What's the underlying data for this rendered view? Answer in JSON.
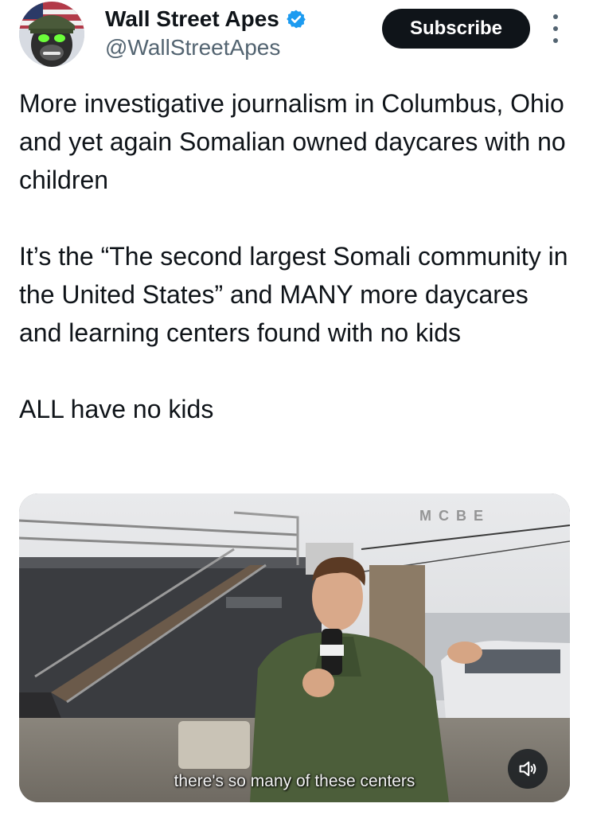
{
  "tweet": {
    "author": {
      "display_name": "Wall Street Apes",
      "handle": "@WallStreetApes",
      "verified": true,
      "verified_color": "#1d9bf0"
    },
    "subscribe_label": "Subscribe",
    "paragraphs": [
      "More investigative journalism in Columbus, Ohio and yet again Somalian owned daycares with no children",
      "It’s the “The second largest Somali community in the United States” and MANY more daycares and learning centers found with no kids",
      "ALL have no kids"
    ],
    "video": {
      "caption": "there's so many of these centers",
      "watermark": "M C B E",
      "muted_icon": "speaker-volume-icon"
    }
  }
}
